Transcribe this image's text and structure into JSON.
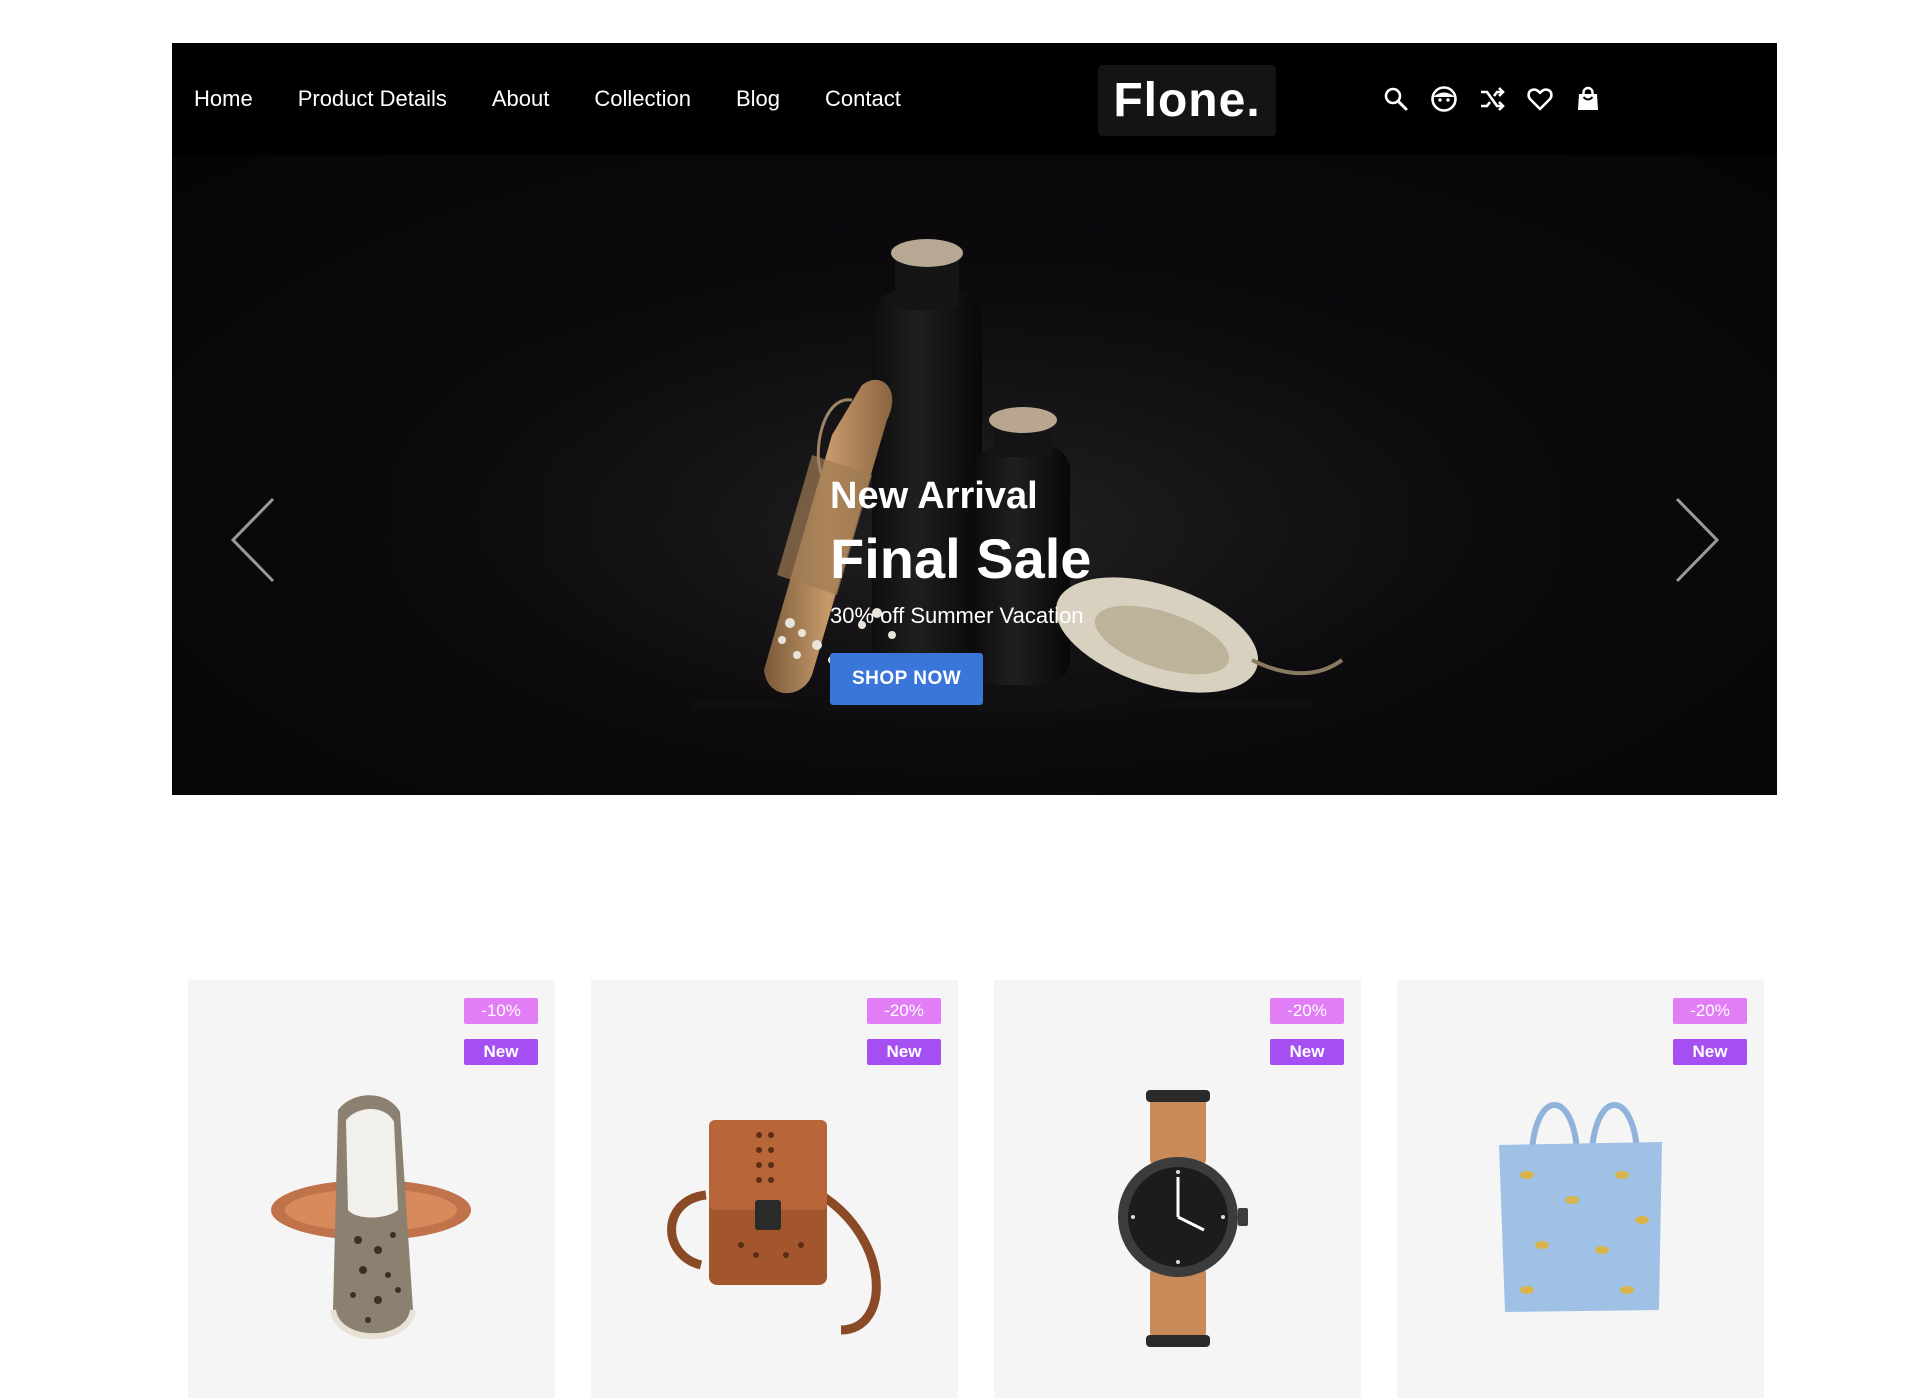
{
  "nav": {
    "items": [
      "Home",
      "Product Details",
      "About",
      "Collection",
      "Blog",
      "Contact"
    ]
  },
  "logo": {
    "text": "Flone."
  },
  "header_icons": [
    "search-icon",
    "account-icon",
    "shuffle-compare-icon",
    "heart-wishlist-icon",
    "shopping-bag-icon"
  ],
  "hero": {
    "subtitle": "New Arrival",
    "title": "Final Sale",
    "description": "30% off Summer Vacation",
    "button_label": "SHOP NOW",
    "button_color": "#3a75d9"
  },
  "products": [
    {
      "discount": "-10%",
      "badge": "New",
      "image": "slip-on-shoe"
    },
    {
      "discount": "-20%",
      "badge": "New",
      "image": "leather-crossbody-bag"
    },
    {
      "discount": "-20%",
      "badge": "New",
      "image": "wrist-watch"
    },
    {
      "discount": "-20%",
      "badge": "New",
      "image": "tote-bag"
    }
  ],
  "colors": {
    "discount_badge": "#e17ef5",
    "new_badge": "#a54ef2",
    "header_bg": "#000000"
  }
}
